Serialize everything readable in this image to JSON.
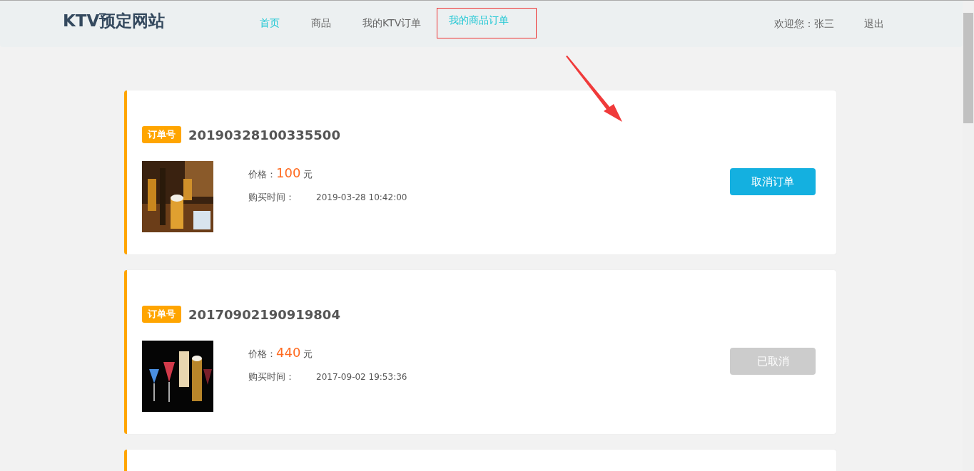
{
  "site_title": "KTV预定网站",
  "nav": [
    {
      "label": "首页",
      "highlighted": true,
      "annotated": false
    },
    {
      "label": "商品",
      "highlighted": false,
      "annotated": false
    },
    {
      "label": "我的KTV订单",
      "highlighted": false,
      "annotated": false
    },
    {
      "label": "我的商品订单",
      "highlighted": true,
      "annotated": true
    }
  ],
  "user": {
    "welcome": "欢迎您：张三",
    "logout": "退出"
  },
  "orders": [
    {
      "kind": "order",
      "tag": "订单号",
      "number": "20190328100335500",
      "price_label": "价格：",
      "price": "100",
      "unit": "元",
      "time_label": "购买时间：",
      "time": "2019-03-28 10:42:00",
      "action": {
        "label": "取消订单",
        "disabled": false
      }
    },
    {
      "kind": "order",
      "tag": "订单号",
      "number": "20170902190919804",
      "price_label": "价格：",
      "price": "440",
      "unit": "元",
      "time_label": "购买时间：",
      "time": "2017-09-02 19:53:36",
      "action": {
        "label": "已取消",
        "disabled": true
      }
    },
    {
      "kind": "cut-off"
    }
  ]
}
